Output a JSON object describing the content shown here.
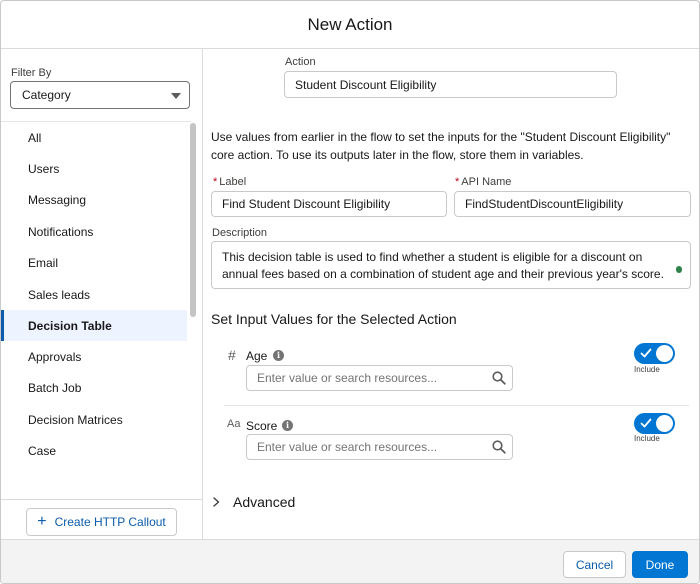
{
  "modal": {
    "title": "New Action"
  },
  "left": {
    "filter_label": "Filter By",
    "filter_value": "Category",
    "categories": [
      "All",
      "Users",
      "Messaging",
      "Notifications",
      "Email",
      "Sales leads",
      "Decision Table",
      "Approvals",
      "Batch Job",
      "Decision Matrices",
      "Case"
    ],
    "active_category": "Decision Table",
    "create_http_callout": "Create HTTP Callout"
  },
  "right": {
    "action_label": "Action",
    "action_value": "Student Discount Eligibility",
    "intro": "Use values from earlier in the flow to set the inputs for the \"Student Discount Eligibility\" core action. To use its outputs later in the flow, store them in variables.",
    "label_label": "Label",
    "label_value": "Find Student Discount Eligibility",
    "api_name_label": "API Name",
    "api_name_value": "FindStudentDiscountEligibility",
    "description_label": "Description",
    "description_value": "This decision table is used to find whether a student is eligible for a discount on annual fees based on a combination of student age and their previous year's score.",
    "section_title": "Set Input Values for the Selected Action",
    "inputs": [
      {
        "icon": "#",
        "label": "Age",
        "placeholder": "Enter value or search resources...",
        "include_label": "Include",
        "include": true
      },
      {
        "icon": "Aa",
        "label": "Score",
        "placeholder": "Enter value or search resources...",
        "include_label": "Include",
        "include": true
      }
    ],
    "advanced": "Advanced"
  },
  "footer": {
    "cancel": "Cancel",
    "done": "Done"
  },
  "colors": {
    "brand": "#0176d3",
    "link": "#0b5cab",
    "required": "#ba0517"
  }
}
